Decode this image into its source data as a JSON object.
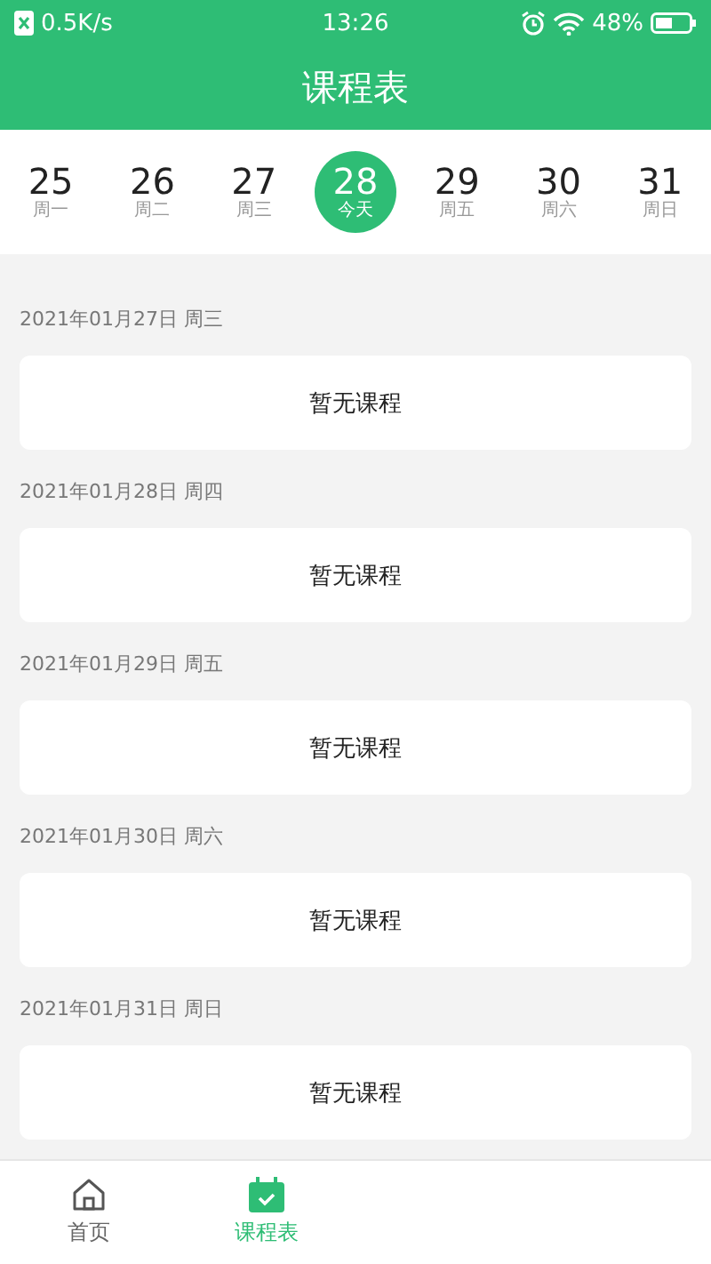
{
  "status_bar": {
    "network_speed": "0.5K/s",
    "time": "13:26",
    "battery": "48%"
  },
  "title": "课程表",
  "week": [
    {
      "day": "25",
      "label": "周一",
      "selected": false
    },
    {
      "day": "26",
      "label": "周二",
      "selected": false
    },
    {
      "day": "27",
      "label": "周三",
      "selected": false
    },
    {
      "day": "28",
      "label": "今天",
      "selected": true
    },
    {
      "day": "29",
      "label": "周五",
      "selected": false
    },
    {
      "day": "30",
      "label": "周六",
      "selected": false
    },
    {
      "day": "31",
      "label": "周日",
      "selected": false
    }
  ],
  "days": [
    {
      "date": "2021年01月27日  周三",
      "empty_text": "暂无课程"
    },
    {
      "date": "2021年01月28日  周四",
      "empty_text": "暂无课程"
    },
    {
      "date": "2021年01月29日  周五",
      "empty_text": "暂无课程"
    },
    {
      "date": "2021年01月30日  周六",
      "empty_text": "暂无课程"
    },
    {
      "date": "2021年01月31日  周日",
      "empty_text": "暂无课程"
    }
  ],
  "bottom_nav": [
    {
      "label": "首页",
      "kind": "home",
      "selected": false
    },
    {
      "label": "课程表",
      "kind": "calendar",
      "selected": true
    }
  ]
}
